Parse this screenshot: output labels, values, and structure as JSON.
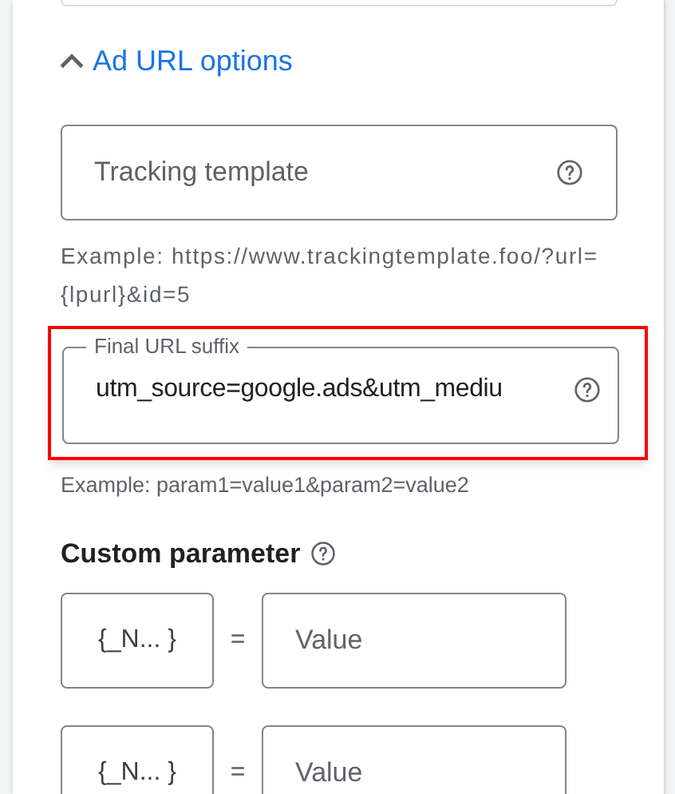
{
  "section": {
    "title": "Ad URL options",
    "expanded": true
  },
  "tracking_template": {
    "placeholder": "Tracking template",
    "hint": "Example: https://www.trackingtemplate.foo/?url={lpurl}&id=5"
  },
  "final_url_suffix": {
    "label": "Final URL suffix",
    "value": "utm_source=google.ads&utm_mediu",
    "highlighted": true,
    "hint": "Example: param1=value1&param2=value2"
  },
  "custom_parameter": {
    "title": "Custom parameter",
    "rows": [
      {
        "name": "{_N... }",
        "equals": "=",
        "placeholder": "Value"
      },
      {
        "name": "{_N... }",
        "equals": "=",
        "placeholder": "Value"
      }
    ]
  }
}
